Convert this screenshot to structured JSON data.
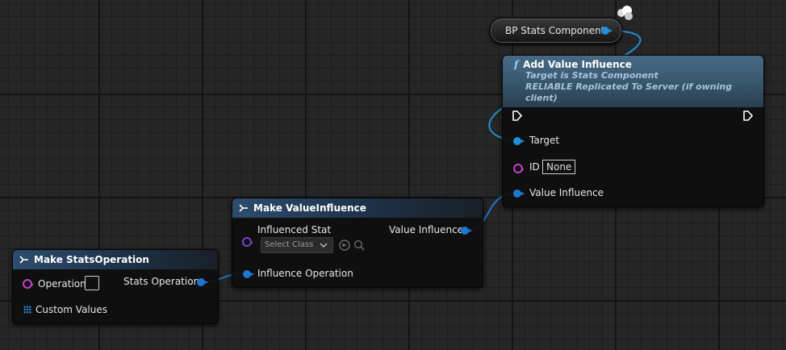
{
  "graph": {
    "var_node": {
      "label": "BP Stats Component"
    },
    "add_value_influence": {
      "title": "Add Value Influence",
      "subtitle_1": "Target is Stats Component",
      "subtitle_2": "RELIABLE Replicated To Server (if owning client)",
      "target_label": "Target",
      "id_label": "ID",
      "id_value": "None",
      "value_influence_label": "Value Influence"
    },
    "make_value_influence": {
      "title": "Make ValueInfluence",
      "influenced_stat_label": "Influenced Stat",
      "select_class_placeholder": "Select Class",
      "value_influence_label": "Value Influence",
      "influence_operation_label": "Influence Operation"
    },
    "make_stats_operation": {
      "title": "Make StatsOperation",
      "operation_label": "Operation",
      "stats_operation_label": "Stats Operation",
      "custom_values_label": "Custom Values"
    }
  },
  "colors": {
    "object_pin": "#1f8fd6",
    "struct_pin": "#1e78d0",
    "name_pin": "#c93ed0",
    "class_pin": "#7a44c8"
  }
}
